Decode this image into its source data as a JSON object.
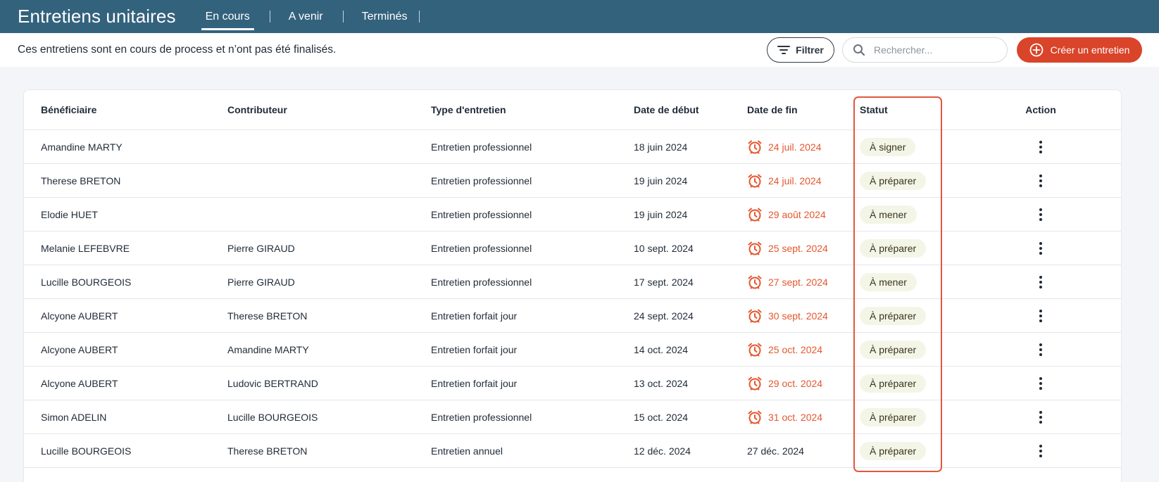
{
  "header": {
    "title": "Entretiens unitaires",
    "tabs": [
      {
        "label": "En cours",
        "active": true
      },
      {
        "label": "A venir",
        "active": false
      },
      {
        "label": "Terminés",
        "active": false
      }
    ]
  },
  "subheader": {
    "description": "Ces entretiens sont en cours de process et n’ont pas été finalisés.",
    "filter_label": "Filtrer",
    "search_placeholder": "Rechercher...",
    "create_label": "Créer un entretien"
  },
  "table": {
    "columns": [
      "Bénéficiaire",
      "Contributeur",
      "Type d'entretien",
      "Date de début",
      "Date de fin",
      "Statut",
      "Action"
    ],
    "rows": [
      {
        "beneficiaire": "Amandine MARTY",
        "contributeur": "",
        "type": "Entretien professionnel",
        "debut": "18 juin 2024",
        "fin": "24 juil. 2024",
        "overdue": true,
        "statut": "À signer"
      },
      {
        "beneficiaire": "Therese BRETON",
        "contributeur": "",
        "type": "Entretien professionnel",
        "debut": "19 juin 2024",
        "fin": "24 juil. 2024",
        "overdue": true,
        "statut": "À préparer"
      },
      {
        "beneficiaire": "Elodie HUET",
        "contributeur": "",
        "type": "Entretien professionnel",
        "debut": "19 juin 2024",
        "fin": "29 août 2024",
        "overdue": true,
        "statut": "À mener"
      },
      {
        "beneficiaire": "Melanie LEFEBVRE",
        "contributeur": "Pierre GIRAUD",
        "type": "Entretien professionnel",
        "debut": "10 sept. 2024",
        "fin": "25 sept. 2024",
        "overdue": true,
        "statut": "À préparer"
      },
      {
        "beneficiaire": "Lucille BOURGEOIS",
        "contributeur": "Pierre GIRAUD",
        "type": "Entretien professionnel",
        "debut": "17 sept. 2024",
        "fin": "27 sept. 2024",
        "overdue": true,
        "statut": "À mener"
      },
      {
        "beneficiaire": "Alcyone AUBERT",
        "contributeur": "Therese BRETON",
        "type": "Entretien forfait jour",
        "debut": "24 sept. 2024",
        "fin": "30 sept. 2024",
        "overdue": true,
        "statut": "À préparer"
      },
      {
        "beneficiaire": "Alcyone AUBERT",
        "contributeur": "Amandine MARTY",
        "type": "Entretien forfait jour",
        "debut": "14 oct. 2024",
        "fin": "25 oct. 2024",
        "overdue": true,
        "statut": "À préparer"
      },
      {
        "beneficiaire": "Alcyone AUBERT",
        "contributeur": "Ludovic BERTRAND",
        "type": "Entretien forfait jour",
        "debut": "13 oct. 2024",
        "fin": "29 oct. 2024",
        "overdue": true,
        "statut": "À préparer"
      },
      {
        "beneficiaire": "Simon ADELIN",
        "contributeur": "Lucille BOURGEOIS",
        "type": "Entretien professionnel",
        "debut": "15 oct. 2024",
        "fin": "31 oct. 2024",
        "overdue": true,
        "statut": "À préparer"
      },
      {
        "beneficiaire": "Lucille BOURGEOIS",
        "contributeur": "Therese BRETON",
        "type": "Entretien annuel",
        "debut": "12 déc. 2024",
        "fin": "27 déc. 2024",
        "overdue": false,
        "statut": "À préparer"
      }
    ]
  },
  "colors": {
    "header_bg": "#33627d",
    "accent": "#d9442a",
    "overdue": "#e4572e",
    "badge_bg": "#f3f6e6",
    "highlight": "#e2573e"
  },
  "icons": {
    "filter": "filter-icon",
    "search": "search-icon",
    "create": "plus-circle-icon",
    "overdue": "alarm-clock-icon",
    "action": "more-vertical-icon"
  }
}
